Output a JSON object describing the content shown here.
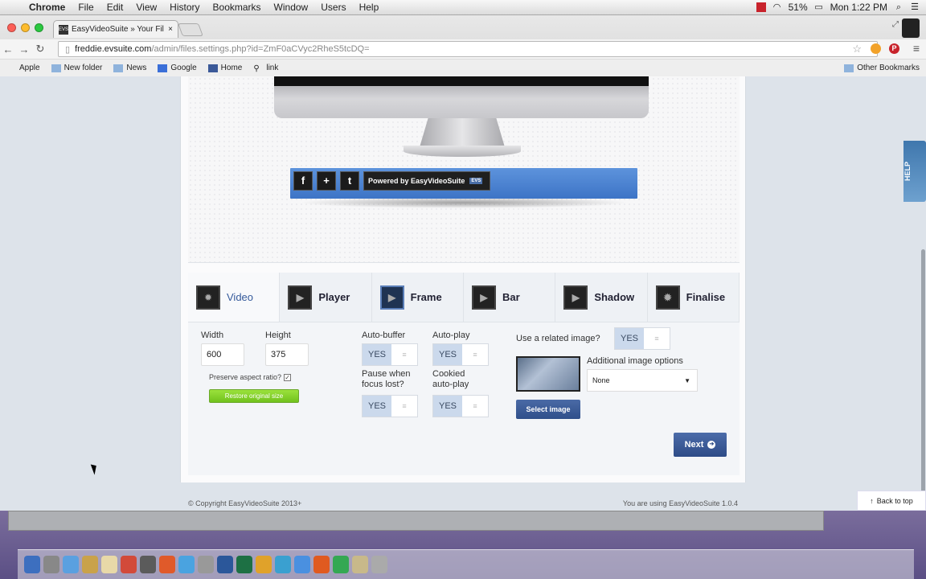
{
  "menubar": {
    "app": "Chrome",
    "items": [
      "File",
      "Edit",
      "View",
      "History",
      "Bookmarks",
      "Window",
      "Users",
      "Help"
    ],
    "battery": "51%",
    "clock": "Mon 1:22 PM"
  },
  "browser": {
    "tab_title": "EasyVideoSuite » Your Fil",
    "url_host": "freddie.evsuite.com",
    "url_path": "/admin/files.settings.php?id=ZmF0aCVyc2RheS5tcDQ=",
    "bookmarks": [
      "Apple",
      "New folder",
      "News",
      "Google",
      "Home",
      "link"
    ],
    "other_bookmarks": "Other Bookmarks"
  },
  "preview": {
    "powered_text": "Powered by EasyVideoSuite",
    "evs_badge": "EVS"
  },
  "tabs": [
    "Video",
    "Player",
    "Frame",
    "Bar",
    "Shadow",
    "Finalise"
  ],
  "settings": {
    "width_label": "Width",
    "width_value": "600",
    "height_label": "Height",
    "height_value": "375",
    "preserve_label": "Preserve aspect ratio?",
    "restore_label": "Restore original size",
    "autobuffer_label": "Auto-buffer",
    "autoplay_label": "Auto-play",
    "pause_label": "Pause when focus lost?",
    "cookied_label": "Cookied auto-play",
    "yes": "YES",
    "no": "≡",
    "related_image_label": "Use a related image?",
    "additional_label": "Additional image options",
    "select_value": "None",
    "select_image_label": "Select image",
    "next_label": "Next"
  },
  "footer": {
    "copyright": "© Copyright EasyVideoSuite 2013+",
    "version": "You are using EasyVideoSuite 1.0.4",
    "back_to_top": "Back to top"
  },
  "help_tab": "HELP",
  "colors": {
    "accent_blue": "#3d74c6",
    "green_button": "#71c21d",
    "toggle_yes": "#cbd9ec"
  }
}
